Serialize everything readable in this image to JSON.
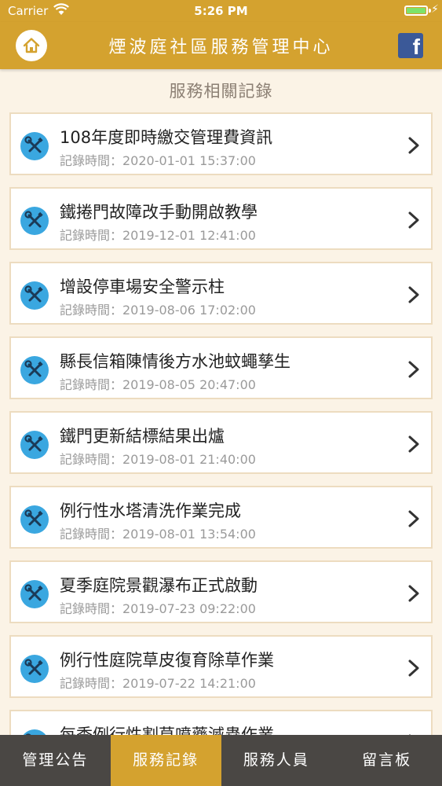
{
  "status": {
    "carrier": "Carrier",
    "time": "5:26 PM"
  },
  "navbar": {
    "title": "煙波庭社區服務管理中心",
    "home_icon": "home-icon",
    "facebook_icon": "facebook-icon",
    "facebook_glyph": "f"
  },
  "section_title": "服務相關記錄",
  "records": [
    {
      "title": "108年度即時繳交管理費資訊",
      "time": "記錄時間：2020-01-01 15:37:00"
    },
    {
      "title": "鐵捲門故障改手動開啟教學",
      "time": "記錄時間：2019-12-01 12:41:00"
    },
    {
      "title": "增設停車場安全警示柱",
      "time": "記錄時間：2019-08-06 17:02:00"
    },
    {
      "title": "縣長信箱陳情後方水池蚊蠅孳生",
      "time": "記錄時間：2019-08-05 20:47:00"
    },
    {
      "title": "鐵門更新結標結果出爐",
      "time": "記錄時間：2019-08-01 21:40:00"
    },
    {
      "title": "例行性水塔清洗作業完成",
      "time": "記錄時間：2019-08-01 13:54:00"
    },
    {
      "title": "夏季庭院景觀瀑布正式啟動",
      "time": "記錄時間：2019-07-23 09:22:00"
    },
    {
      "title": "例行性庭院草皮復育除草作業",
      "time": "記錄時間：2019-07-22 14:21:00"
    },
    {
      "title": "每季例行性割草噴藥滅蟲作業",
      "time": ""
    }
  ],
  "tabs": [
    {
      "label": "管理公告",
      "active": false
    },
    {
      "label": "服務記錄",
      "active": true
    },
    {
      "label": "服務人員",
      "active": false
    },
    {
      "label": "留言板",
      "active": false
    }
  ],
  "colors": {
    "primary": "#d4a22f",
    "background": "#fbf3e6",
    "tabbar": "#4a4744",
    "tool_icon": "#3aa7e0"
  }
}
